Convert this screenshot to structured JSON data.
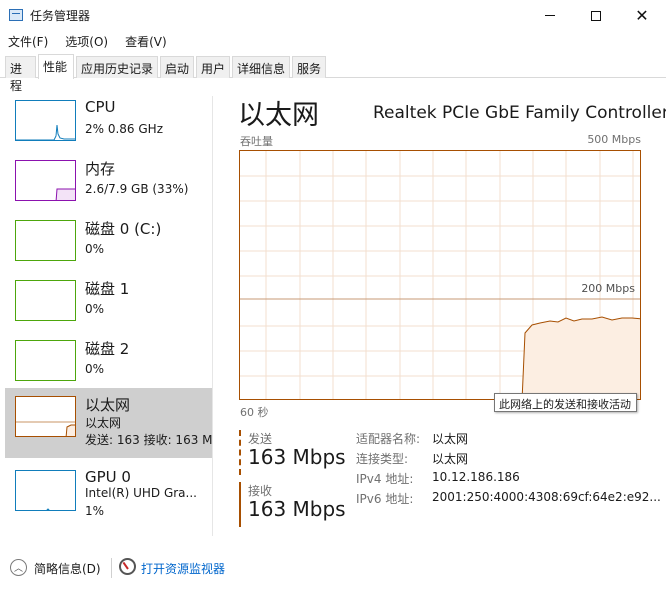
{
  "window": {
    "title": "任务管理器",
    "controls": {
      "minimize": "—",
      "maximize": "☐",
      "close": "✕"
    }
  },
  "menu": [
    "文件(F)",
    "选项(O)",
    "查看(V)"
  ],
  "tabs": [
    "进程",
    "性能",
    "应用历史记录",
    "启动",
    "用户",
    "详细信息",
    "服务"
  ],
  "active_tab": "性能",
  "sidebar": {
    "items": [
      {
        "name": "CPU",
        "line1": "2%  0.86 GHz",
        "line2": "",
        "color": "#117dbb"
      },
      {
        "name": "内存",
        "line1": "2.6/7.9 GB (33%)",
        "line2": "",
        "color": "#8b12ae"
      },
      {
        "name": "磁盘 0 (C:)",
        "line1": "0%",
        "line2": "",
        "color": "#4da60c"
      },
      {
        "name": "磁盘 1",
        "line1": "0%",
        "line2": "",
        "color": "#4da60c"
      },
      {
        "name": "磁盘 2",
        "line1": "0%",
        "line2": "",
        "color": "#4da60c"
      },
      {
        "name": "以太网",
        "line1": "以太网",
        "line2": "发送: 163  接收: 163 M",
        "color": "#a74f01"
      },
      {
        "name": "GPU 0",
        "line1": "Intel(R) UHD Gra...",
        "line2": "1%",
        "color": "#117dbb"
      }
    ],
    "selected": "以太网"
  },
  "main": {
    "title": "以太网",
    "device": "Realtek PCIe GbE Family Controller",
    "graph": {
      "label_left": "吞吐量",
      "label_right": "500 Mbps",
      "mid_label": "200 Mbps",
      "x_left": "60 秒",
      "tooltip": "此网络上的发送和接收活动",
      "accent": "#a74f01",
      "fill": "#fceee2"
    },
    "send": {
      "label": "发送",
      "value": "163 Mbps"
    },
    "recv": {
      "label": "接收",
      "value": "163 Mbps"
    },
    "info": [
      {
        "key": "适配器名称:",
        "value": "以太网"
      },
      {
        "key": "连接类型:",
        "value": "以太网"
      },
      {
        "key": "IPv4 地址:",
        "value": "10.12.186.186"
      },
      {
        "key": "IPv6 地址:",
        "value": "2001:250:4000:4308:69cf:64e2:e92..."
      }
    ]
  },
  "bottom": {
    "fewer_details": "简略信息(D)",
    "open_resmon": "打开资源监视器"
  }
}
